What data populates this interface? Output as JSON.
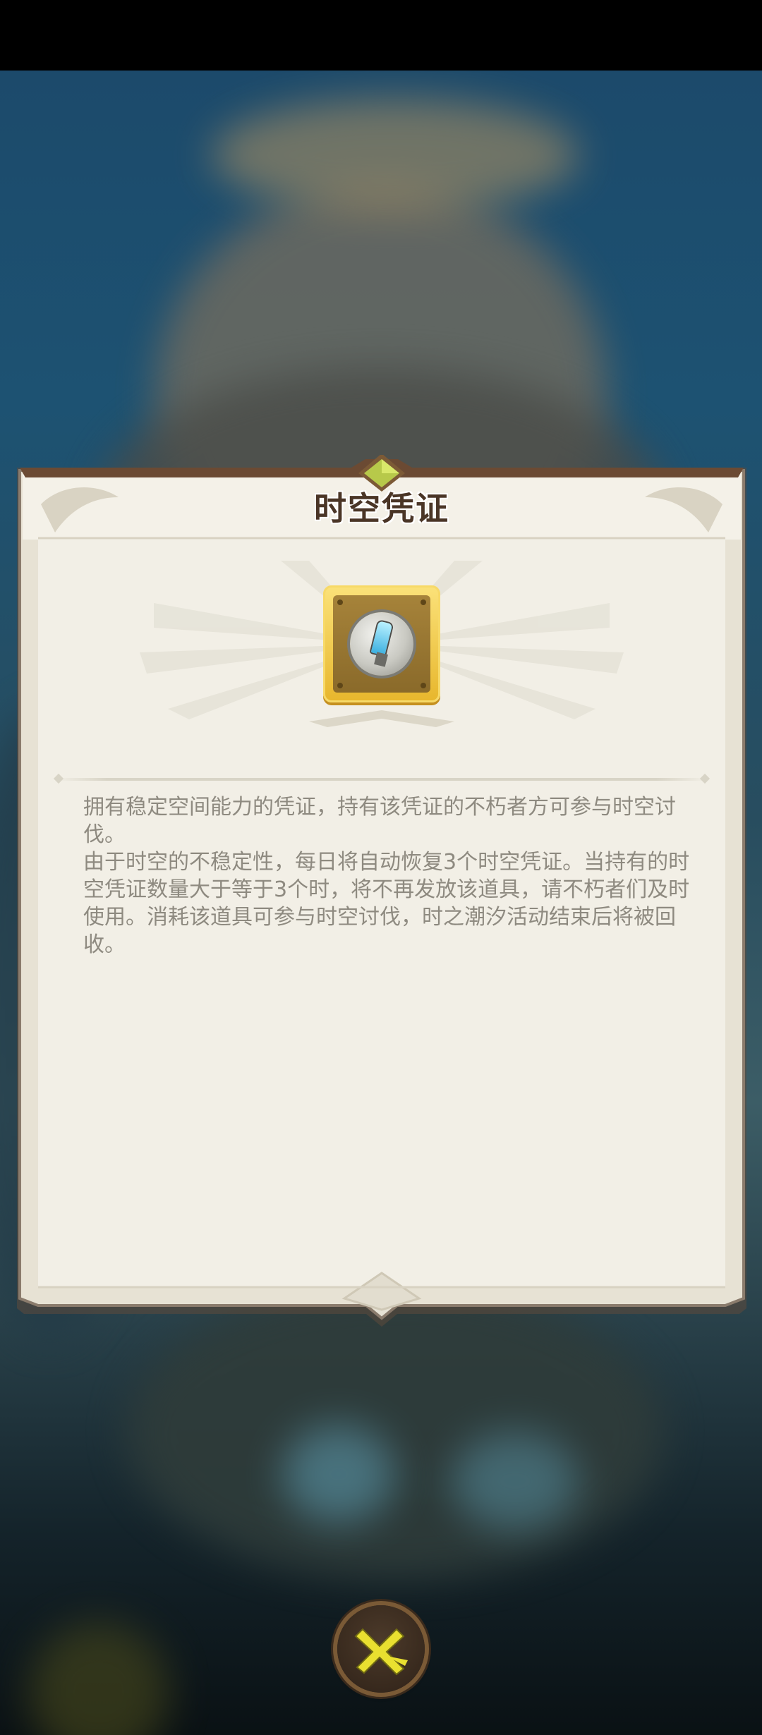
{
  "dialog": {
    "title": "时空凭证",
    "item_icon": "time-space-voucher-icon",
    "description": [
      "拥有稳定空间能力的凭证，持有该凭证的不朽者方可参与时空讨伐。",
      "由于时空的不稳定性，每日将自动恢复3个时空凭证。当持有的时空凭证数量大于等于3个时，将不再发放该道具，请不朽者们及时使用。消耗该道具可参与时空讨伐，时之潮汐活动结束后将被回收。"
    ]
  },
  "close_button": {
    "icon": "close-icon"
  },
  "colors": {
    "panel": "#f2efe6",
    "frame": "#6b4a33",
    "item_gold": "#e7b62c",
    "close_x": "#e9e030"
  }
}
